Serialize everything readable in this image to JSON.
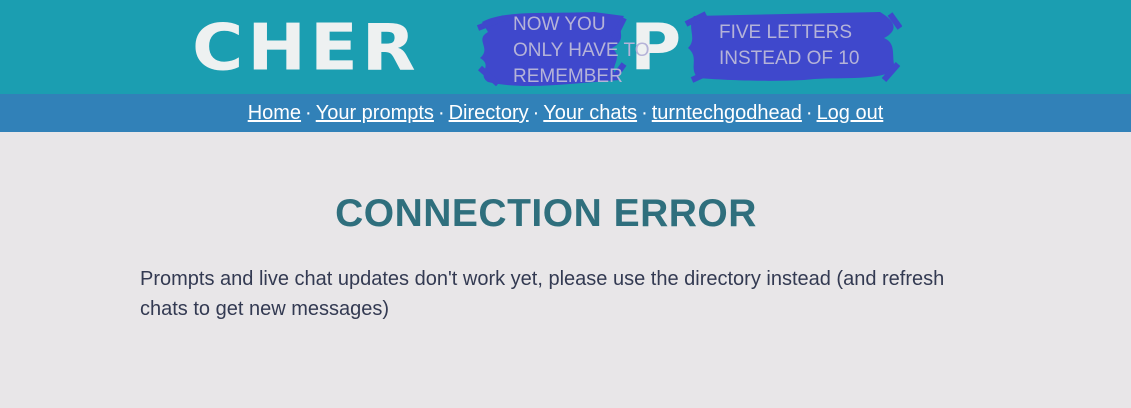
{
  "header": {
    "logo_text": "CHEROP",
    "logo_parts": [
      "CHER",
      "P"
    ],
    "scribble_text_1": "NOW YOU\nONLY HAVE TO\nREMEMBER",
    "scribble_text_2": "FIVE LETTERS\nINSTEAD OF 10",
    "header_color": "#1b9eb1",
    "scribble_color": "#3f48cc"
  },
  "nav": {
    "items": [
      {
        "label": "Home"
      },
      {
        "label": "Your prompts"
      },
      {
        "label": "Directory"
      },
      {
        "label": "Your chats"
      },
      {
        "label": "turntechgodhead"
      },
      {
        "label": "Log out"
      }
    ],
    "separator": "·",
    "nav_color": "#3181b8"
  },
  "main": {
    "title": "CONNECTION ERROR",
    "message": "Prompts and live chat updates don't work yet, please use the directory instead (and refresh chats to get new messages)"
  }
}
